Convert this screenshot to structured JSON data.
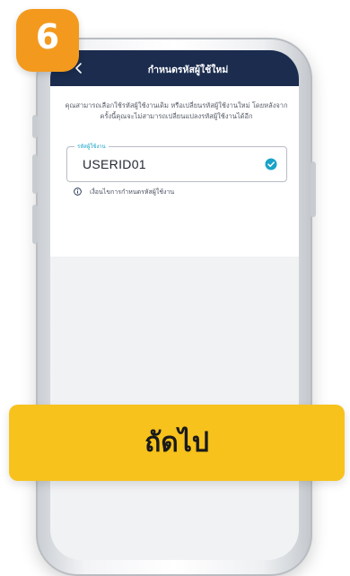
{
  "step_badge": {
    "number": "6",
    "color": "#f39a1e"
  },
  "header": {
    "title": "กำหนดรหัสผู้ใช้ใหม่",
    "back_icon": "chevron-left-icon",
    "color": "#1b2c4f"
  },
  "description": "คุณสามารถเลือกใช้รหัสผู้ใช้งานเดิม หรือเปลี่ยนรหัสผู้ใช้งานใหม่ โดยหลังจากครั้งนี้คุณจะไม่สามารถเปลี่ยนแปลงรหัสผู้ใช้งานได้อีก",
  "user_id_field": {
    "label": "รหัสผู้ใช้งาน",
    "value": "USERID01",
    "status_icon": "check-circle-icon",
    "accent": "#1aa3c8"
  },
  "hint": {
    "icon": "info-icon",
    "text": "เงื่อนไขการกำหนดรหัสผู้ใช้งาน"
  },
  "next_button": {
    "label": "ถัดไป",
    "color": "#f7c21c"
  }
}
